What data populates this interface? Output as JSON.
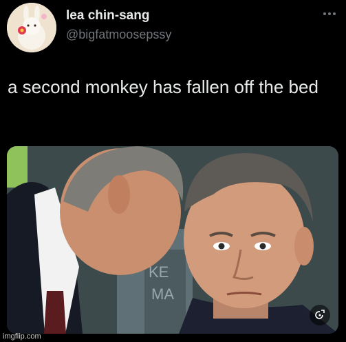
{
  "post": {
    "display_name": "lea chin-sang",
    "handle": "@bigfatmoosepssy",
    "text": "a second monkey has fallen off the bed"
  },
  "media": {
    "sign_text": "KE\nMA"
  },
  "icons": {
    "more": "more-horizontal-icon",
    "media_action": "search-image-icon"
  },
  "watermark": "imgflip.com",
  "colors": {
    "background": "#000000",
    "primary_text": "#e7e9ea",
    "secondary_text": "#71767b"
  }
}
